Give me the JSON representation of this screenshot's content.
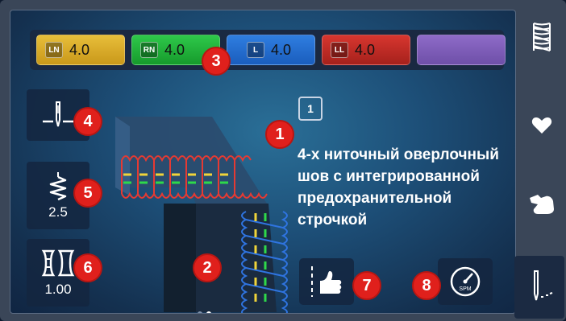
{
  "threads": [
    {
      "label": "LN",
      "value": "4.0",
      "color": "#e8be3a"
    },
    {
      "label": "RN",
      "value": "4.0",
      "color": "#2ec94a"
    },
    {
      "label": "L",
      "value": "4.0",
      "color": "#2f7ee0"
    },
    {
      "label": "LL",
      "value": "4.0",
      "color": "#d8362f"
    },
    {
      "label": "",
      "value": "",
      "color": "#8e6bc8"
    }
  ],
  "page_number": "1",
  "description": "4-х ниточный оверлочный шов с интегрированной предохранительной строчкой",
  "stitch_length": "2.5",
  "differential_feed": "1.00",
  "callouts": [
    "1",
    "2",
    "3",
    "4",
    "5",
    "6",
    "7",
    "8"
  ],
  "speed_icon_label": "SPM",
  "icons": {
    "needle": "needle-position-icon",
    "stitch_length": "stitch-length-icon",
    "differential": "differential-feed-icon",
    "hand_guide": "hand-guide-icon",
    "speed": "speedometer-icon",
    "stitch_menu": "stitch-pattern-icon",
    "favorite": "heart-icon",
    "tutorial": "hand-icon",
    "sewing": "sewing-needle-icon"
  }
}
